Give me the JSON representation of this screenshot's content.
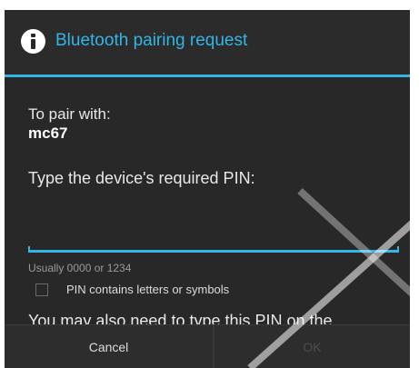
{
  "dialog": {
    "title": "Bluetooth pairing request",
    "icon": "info-icon",
    "accent_color": "#33b5e5"
  },
  "content": {
    "pair_label": "To pair with:",
    "device_name": "mc67",
    "pin_prompt": "Type the device's required PIN:",
    "pin_value": "",
    "hint": "Usually 0000 or 1234",
    "checkbox_label": "PIN contains letters or symbols",
    "checkbox_checked": false,
    "also_text": "You may also need to type this PIN on the"
  },
  "buttons": {
    "cancel_label": "Cancel",
    "ok_label": "OK"
  }
}
